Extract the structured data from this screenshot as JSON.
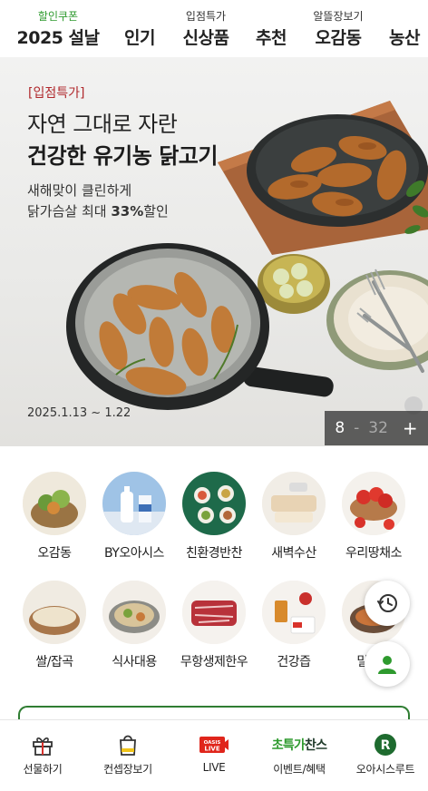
{
  "topnav": {
    "tabs": [
      {
        "sup": "할인쿠폰",
        "label": "2025 설날"
      },
      {
        "sup": "",
        "label": "인기"
      },
      {
        "sup": "입점특가",
        "label": "신상품"
      },
      {
        "sup": "",
        "label": "추천"
      },
      {
        "sup": "알뜰장보기",
        "label": "오감동"
      },
      {
        "sup": "",
        "label": "농산"
      }
    ]
  },
  "banner": {
    "tag": "[입점특가]",
    "title_line1": "자연 그대로 자란",
    "title_line2": "건강한 유기농 닭고기",
    "sub_line1": "새해맞이 클린하게",
    "sub_line2_pre": "닭가슴살 최대 ",
    "sub_line2_bold": "33%",
    "sub_line2_post": "할인",
    "date": "2025.1.13 ~ 1.22",
    "counter": {
      "current": "8",
      "separator": "-",
      "total": "32",
      "plus": "+"
    }
  },
  "categories": [
    {
      "label": "오감동",
      "icon": "basket-image"
    },
    {
      "label": "BY오아시스",
      "icon": "milk-bottle-image"
    },
    {
      "label": "친환경반찬",
      "icon": "side-dish-image"
    },
    {
      "label": "새벽수산",
      "icon": "fish-fillet-image"
    },
    {
      "label": "우리땅채소",
      "icon": "tomato-image"
    },
    {
      "label": "쌀/잡곡",
      "icon": "rice-bowl-image"
    },
    {
      "label": "식사대용",
      "icon": "meal-plate-image"
    },
    {
      "label": "무항생제한우",
      "icon": "beef-image"
    },
    {
      "label": "건강즙",
      "icon": "juice-image"
    },
    {
      "label": "밀키트",
      "icon": "mealkit-image"
    }
  ],
  "bottombar": {
    "items": [
      {
        "label": "선물하기",
        "icon": "gift-icon"
      },
      {
        "label": "컨셉장보기",
        "icon": "shopping-bag-icon"
      },
      {
        "label": "LIVE",
        "icon": "oasis-live-icon",
        "badge_top": "OASIS",
        "badge_bottom": "LIVE"
      },
      {
        "label": "이벤트/혜택",
        "icon": "special-price-chance-icon",
        "badge_green": "초특가",
        "badge_dark": "찬스"
      },
      {
        "label": "오아시스루트",
        "icon": "r-circle-icon",
        "badge_letter": "R"
      }
    ]
  },
  "colors": {
    "accent_green": "#2e9a2e",
    "tag_red": "#b0282c",
    "brand_dark_green": "#1e6b2f",
    "live_red": "#e0251b"
  }
}
